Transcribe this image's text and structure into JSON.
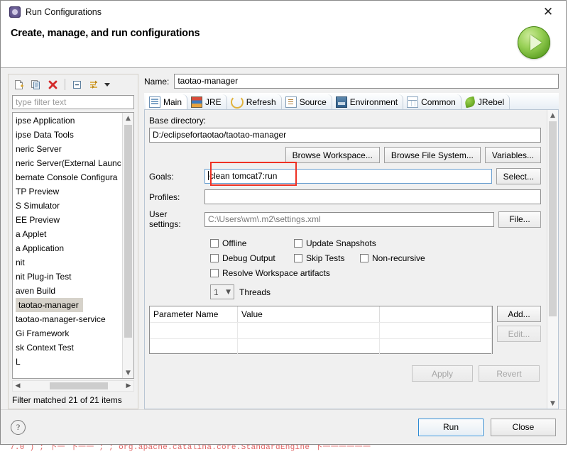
{
  "window": {
    "title": "Run Configurations",
    "title_icon": "run-config-icon",
    "close_label": "✕",
    "header_title": "Create, manage, and run configurations",
    "header_icon": "green-run-play-icon"
  },
  "sidebar": {
    "toolbar": [
      {
        "name": "new-configuration-icon",
        "tooltip": "New launch configuration"
      },
      {
        "name": "duplicate-configuration-icon",
        "tooltip": "Duplicate currently selected launch configuration"
      },
      {
        "name": "delete-configuration-icon",
        "tooltip": "Delete selected launch configuration(s)"
      },
      {
        "name": "collapse-all-icon",
        "tooltip": "Collapse All"
      },
      {
        "name": "filter-icon",
        "tooltip": "Filter launch configurations"
      },
      {
        "name": "view-menu-caret-icon",
        "tooltip": "View Menu"
      }
    ],
    "filter_placeholder": "type filter text",
    "items": [
      {
        "label": "ipse Application",
        "selected": false
      },
      {
        "label": "ipse Data Tools",
        "selected": false
      },
      {
        "label": "neric Server",
        "selected": false
      },
      {
        "label": "neric Server(External Launc",
        "selected": false
      },
      {
        "label": "bernate Console Configura",
        "selected": false
      },
      {
        "label": "TP Preview",
        "selected": false
      },
      {
        "label": "S Simulator",
        "selected": false
      },
      {
        "label": "EE Preview",
        "selected": false
      },
      {
        "label": "a Applet",
        "selected": false
      },
      {
        "label": "a Application",
        "selected": false
      },
      {
        "label": "nit",
        "selected": false
      },
      {
        "label": "nit Plug-in Test",
        "selected": false
      },
      {
        "label": "aven Build",
        "selected": false
      },
      {
        "label": "taotao-manager",
        "selected": true
      },
      {
        "label": "taotao-manager-service",
        "selected": false
      },
      {
        "label": "Gi Framework",
        "selected": false
      },
      {
        "label": "sk Context Test",
        "selected": false
      },
      {
        "label": "L",
        "selected": false
      }
    ],
    "status": "Filter matched 21 of 21 items"
  },
  "form": {
    "name_label": "Name:",
    "name_value": "taotao-manager",
    "tabs": [
      {
        "label": "Main",
        "icon": "main-tab-icon",
        "active": true
      },
      {
        "label": "JRE",
        "icon": "jre-tab-icon",
        "active": false
      },
      {
        "label": "Refresh",
        "icon": "refresh-tab-icon",
        "active": false
      },
      {
        "label": "Source",
        "icon": "source-tab-icon",
        "active": false
      },
      {
        "label": "Environment",
        "icon": "environment-tab-icon",
        "active": false
      },
      {
        "label": "Common",
        "icon": "common-tab-icon",
        "active": false
      },
      {
        "label": "JRebel",
        "icon": "jrebel-tab-icon",
        "active": false
      }
    ],
    "base_directory_label": "Base directory:",
    "base_directory_value": "D:/eclipsefortaotao/taotao-manager",
    "browse_workspace_label": "Browse Workspace...",
    "browse_filesystem_label": "Browse File System...",
    "variables_label": "Variables...",
    "goals_label": "Goals:",
    "goals_value": "clean tomcat7:run",
    "goals_select_label": "Select...",
    "goals_highlight_color": "#ee3124",
    "profiles_label": "Profiles:",
    "profiles_value": "",
    "user_settings_label": "User settings:",
    "user_settings_value": "C:\\Users\\wm\\.m2\\settings.xml",
    "user_settings_file_label": "File...",
    "checkboxes": [
      {
        "label": "Offline",
        "checked": false
      },
      {
        "label": "Update Snapshots",
        "checked": false
      },
      {
        "label": "Debug Output",
        "checked": false
      },
      {
        "label": "Skip Tests",
        "checked": false
      },
      {
        "label": "Non-recursive",
        "checked": false
      },
      {
        "label": "Resolve Workspace artifacts",
        "checked": false
      }
    ],
    "threads_value": "1",
    "threads_label": "Threads",
    "param_table": {
      "columns": [
        "Parameter Name",
        "Value",
        ""
      ],
      "rows": []
    },
    "add_label": "Add...",
    "edit_label": "Edit...",
    "apply_label": "Apply",
    "revert_label": "Revert"
  },
  "footer": {
    "help_glyph": "?",
    "run_label": "Run",
    "close_label": "Close",
    "run_accent": "#2d8ad4"
  },
  "background": {
    "console_line": "7.0 )  ; 下一 下一一 ; ; org.apache.catalina.core.StandardEngine  下一一一一一一"
  }
}
